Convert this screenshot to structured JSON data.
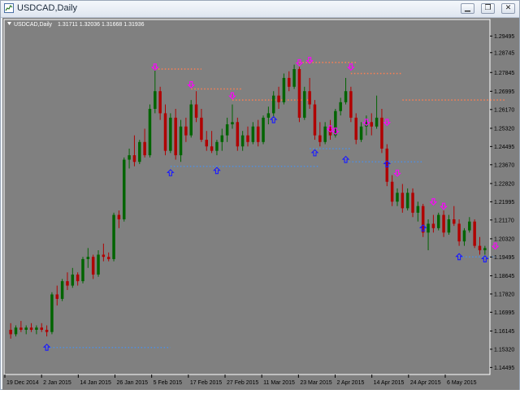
{
  "window": {
    "title": "USDCAD,Daily",
    "buttons": [
      "minimize",
      "restore",
      "close"
    ]
  },
  "chart_info": {
    "symbol_label": "USDCAD,Daily",
    "ohlc": "1.31711 1.32036 1.31668 1.31936",
    "dropdown_icon": "triangle-down-icon"
  },
  "colors": {
    "background": "#808080",
    "bull": "#006400",
    "bear": "#b00000",
    "resistance_dots": "#ff7f50",
    "support_dots": "#4f8fe0",
    "up_arrow": "#1a1aff",
    "down_arrow": "#ff00ff",
    "axis_text": "#000000"
  },
  "chart_data": {
    "type": "candlestick",
    "price_labels": [
      "1.29495",
      "1.28745",
      "1.27845",
      "1.26995",
      "1.26170",
      "1.25320",
      "1.24495",
      "1.23670",
      "1.22820",
      "1.21995",
      "1.21170",
      "1.20320",
      "1.19495",
      "1.18645",
      "1.17820",
      "1.16995",
      "1.16145",
      "1.15320",
      "1.14495"
    ],
    "date_labels": [
      "19 Dec 2014",
      "2 Jan 2015",
      "14 Jan 2015",
      "26 Jan 2015",
      "5 Feb 2015",
      "17 Feb 2015",
      "27 Feb 2015",
      "11 Mar 2015",
      "23 Mar 2015",
      "2 Apr 2015",
      "14 Apr 2015",
      "24 Apr 2015",
      "6 May 2015"
    ],
    "y_range": [
      1.1425,
      1.2995
    ],
    "candles": [
      [
        1.162,
        1.165,
        1.158,
        1.16
      ],
      [
        1.16,
        1.164,
        1.159,
        1.163
      ],
      [
        1.163,
        1.166,
        1.161,
        1.162
      ],
      [
        1.162,
        1.164,
        1.16,
        1.163
      ],
      [
        1.163,
        1.165,
        1.161,
        1.162
      ],
      [
        1.162,
        1.164,
        1.16,
        1.163
      ],
      [
        1.163,
        1.165,
        1.161,
        1.162
      ],
      [
        1.162,
        1.164,
        1.159,
        1.161
      ],
      [
        1.161,
        1.179,
        1.16,
        1.178
      ],
      [
        1.178,
        1.182,
        1.173,
        1.176
      ],
      [
        1.176,
        1.185,
        1.175,
        1.184
      ],
      [
        1.184,
        1.188,
        1.18,
        1.182
      ],
      [
        1.182,
        1.19,
        1.181,
        1.187
      ],
      [
        1.187,
        1.188,
        1.182,
        1.184
      ],
      [
        1.184,
        1.195,
        1.183,
        1.194
      ],
      [
        1.194,
        1.199,
        1.19,
        1.195
      ],
      [
        1.195,
        1.196,
        1.185,
        1.187
      ],
      [
        1.187,
        1.198,
        1.186,
        1.196
      ],
      [
        1.196,
        1.201,
        1.193,
        1.195
      ],
      [
        1.195,
        1.197,
        1.193,
        1.194
      ],
      [
        1.194,
        1.215,
        1.193,
        1.214
      ],
      [
        1.214,
        1.216,
        1.208,
        1.212
      ],
      [
        1.212,
        1.24,
        1.211,
        1.239
      ],
      [
        1.239,
        1.244,
        1.235,
        1.241
      ],
      [
        1.241,
        1.25,
        1.236,
        1.238
      ],
      [
        1.238,
        1.248,
        1.237,
        1.247
      ],
      [
        1.247,
        1.253,
        1.24,
        1.241
      ],
      [
        1.241,
        1.264,
        1.24,
        1.262
      ],
      [
        1.262,
        1.28,
        1.26,
        1.27
      ],
      [
        1.27,
        1.272,
        1.257,
        1.26
      ],
      [
        1.26,
        1.264,
        1.241,
        1.243
      ],
      [
        1.243,
        1.26,
        1.242,
        1.258
      ],
      [
        1.258,
        1.262,
        1.239,
        1.241
      ],
      [
        1.241,
        1.257,
        1.238,
        1.254
      ],
      [
        1.254,
        1.258,
        1.247,
        1.25
      ],
      [
        1.25,
        1.266,
        1.249,
        1.264
      ],
      [
        1.264,
        1.27,
        1.256,
        1.258
      ],
      [
        1.258,
        1.262,
        1.247,
        1.248
      ],
      [
        1.248,
        1.252,
        1.243,
        1.245
      ],
      [
        1.245,
        1.252,
        1.242,
        1.243
      ],
      [
        1.243,
        1.248,
        1.241,
        1.247
      ],
      [
        1.247,
        1.253,
        1.243,
        1.25
      ],
      [
        1.25,
        1.258,
        1.247,
        1.255
      ],
      [
        1.255,
        1.264,
        1.253,
        1.256
      ],
      [
        1.256,
        1.258,
        1.243,
        1.245
      ],
      [
        1.245,
        1.252,
        1.243,
        1.25
      ],
      [
        1.25,
        1.254,
        1.245,
        1.247
      ],
      [
        1.247,
        1.256,
        1.246,
        1.254
      ],
      [
        1.254,
        1.257,
        1.245,
        1.247
      ],
      [
        1.247,
        1.259,
        1.246,
        1.258
      ],
      [
        1.258,
        1.263,
        1.255,
        1.26
      ],
      [
        1.26,
        1.27,
        1.258,
        1.268
      ],
      [
        1.268,
        1.272,
        1.262,
        1.265
      ],
      [
        1.265,
        1.278,
        1.264,
        1.276
      ],
      [
        1.276,
        1.279,
        1.27,
        1.272
      ],
      [
        1.272,
        1.282,
        1.271,
        1.28
      ],
      [
        1.28,
        1.281,
        1.256,
        1.258
      ],
      [
        1.258,
        1.272,
        1.257,
        1.27
      ],
      [
        1.27,
        1.276,
        1.262,
        1.264
      ],
      [
        1.264,
        1.266,
        1.248,
        1.25
      ],
      [
        1.25,
        1.256,
        1.245,
        1.247
      ],
      [
        1.247,
        1.256,
        1.246,
        1.254
      ],
      [
        1.254,
        1.257,
        1.248,
        1.25
      ],
      [
        1.25,
        1.262,
        1.249,
        1.261
      ],
      [
        1.261,
        1.267,
        1.259,
        1.265
      ],
      [
        1.265,
        1.276,
        1.264,
        1.27
      ],
      [
        1.27,
        1.272,
        1.256,
        1.258
      ],
      [
        1.258,
        1.26,
        1.246,
        1.248
      ],
      [
        1.248,
        1.256,
        1.247,
        1.254
      ],
      [
        1.254,
        1.259,
        1.25,
        1.256
      ],
      [
        1.256,
        1.26,
        1.25,
        1.254
      ],
      [
        1.254,
        1.268,
        1.253,
        1.258
      ],
      [
        1.258,
        1.262,
        1.242,
        1.244
      ],
      [
        1.244,
        1.246,
        1.227,
        1.229
      ],
      [
        1.229,
        1.232,
        1.218,
        1.22
      ],
      [
        1.22,
        1.226,
        1.218,
        1.224
      ],
      [
        1.224,
        1.228,
        1.215,
        1.217
      ],
      [
        1.217,
        1.226,
        1.216,
        1.224
      ],
      [
        1.224,
        1.226,
        1.213,
        1.215
      ],
      [
        1.215,
        1.22,
        1.211,
        1.218
      ],
      [
        1.218,
        1.219,
        1.204,
        1.206
      ],
      [
        1.206,
        1.212,
        1.198,
        1.21
      ],
      [
        1.21,
        1.214,
        1.206,
        1.208
      ],
      [
        1.208,
        1.215,
        1.207,
        1.214
      ],
      [
        1.214,
        1.216,
        1.204,
        1.206
      ],
      [
        1.206,
        1.214,
        1.205,
        1.212
      ],
      [
        1.212,
        1.218,
        1.209,
        1.21
      ],
      [
        1.21,
        1.212,
        1.2,
        1.202
      ],
      [
        1.202,
        1.208,
        1.2,
        1.207
      ],
      [
        1.207,
        1.213,
        1.206,
        1.211
      ],
      [
        1.211,
        1.212,
        1.199,
        1.2
      ],
      [
        1.2,
        1.204,
        1.196,
        1.198
      ],
      [
        1.198,
        1.2,
        1.196,
        1.199
      ]
    ],
    "up_arrows": [
      [
        7,
        1.154
      ],
      [
        31,
        1.233
      ],
      [
        40,
        1.234
      ],
      [
        51,
        1.257
      ],
      [
        59,
        1.242
      ],
      [
        65,
        1.239
      ],
      [
        73,
        1.237
      ],
      [
        80,
        1.208
      ],
      [
        87,
        1.195
      ],
      [
        92,
        1.194
      ]
    ],
    "down_arrows": [
      [
        28,
        1.281
      ],
      [
        35,
        1.273
      ],
      [
        43,
        1.268
      ],
      [
        56,
        1.283
      ],
      [
        58,
        1.284
      ],
      [
        66,
        1.281
      ],
      [
        62,
        1.253
      ],
      [
        63,
        1.252
      ],
      [
        69,
        1.256
      ],
      [
        73,
        1.256
      ],
      [
        75,
        1.233
      ],
      [
        82,
        1.22
      ],
      [
        84,
        1.218
      ],
      [
        94,
        1.2
      ]
    ],
    "resistance_levels": [
      [
        28,
        37,
        1.28
      ],
      [
        35,
        45,
        1.271
      ],
      [
        43,
        58,
        1.266
      ],
      [
        56,
        67,
        1.283
      ],
      [
        66,
        76,
        1.278
      ],
      [
        76,
        96,
        1.266
      ]
    ],
    "support_levels": [
      [
        7,
        31,
        1.154
      ],
      [
        31,
        60,
        1.236
      ],
      [
        58,
        66,
        1.244
      ],
      [
        65,
        80,
        1.238
      ],
      [
        87,
        94,
        1.195
      ]
    ]
  }
}
